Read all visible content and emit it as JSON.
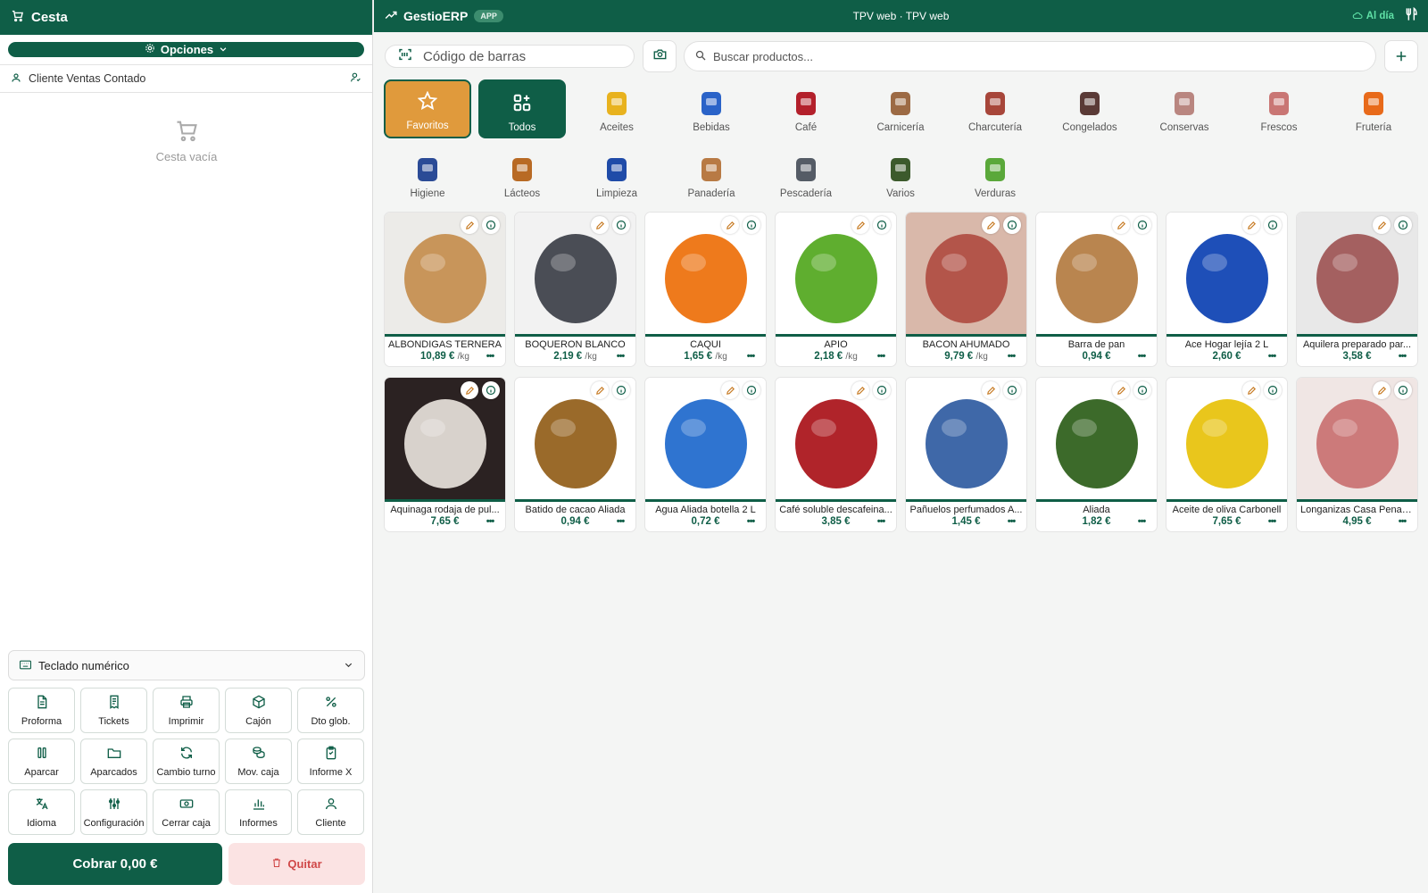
{
  "left": {
    "title": "Cesta",
    "options_label": "Opciones",
    "client": "Cliente Ventas Contado",
    "empty_label": "Cesta vacía",
    "numpad_label": "Teclado numérico",
    "actions": [
      {
        "label": "Proforma",
        "icon": "file-text-icon"
      },
      {
        "label": "Tickets",
        "icon": "receipt-icon"
      },
      {
        "label": "Imprimir",
        "icon": "printer-icon"
      },
      {
        "label": "Cajón",
        "icon": "box-icon"
      },
      {
        "label": "Dto glob.",
        "icon": "percent-icon"
      },
      {
        "label": "Aparcar",
        "icon": "pause-icon"
      },
      {
        "label": "Aparcados",
        "icon": "folder-icon"
      },
      {
        "label": "Cambio turno",
        "icon": "refresh-icon"
      },
      {
        "label": "Mov. caja",
        "icon": "coins-icon"
      },
      {
        "label": "Informe X",
        "icon": "clipboard-icon"
      },
      {
        "label": "Idioma",
        "icon": "translate-icon"
      },
      {
        "label": "Configuración",
        "icon": "sliders-icon"
      },
      {
        "label": "Cerrar caja",
        "icon": "banknote-icon"
      },
      {
        "label": "Informes",
        "icon": "bar-chart-icon"
      },
      {
        "label": "Cliente",
        "icon": "user-icon"
      }
    ],
    "cobrar_label": "Cobrar 0,00 €",
    "quitar_label": "Quitar"
  },
  "topbar": {
    "brand": "GestioERP",
    "badge": "APP",
    "center": "TPV web · TPV web",
    "sync": "Al día"
  },
  "search": {
    "barcode_placeholder": "Código de barras",
    "products_placeholder": "Buscar productos..."
  },
  "categories": [
    {
      "label": "Favoritos",
      "kind": "fav"
    },
    {
      "label": "Todos",
      "kind": "all"
    },
    {
      "label": "Aceites",
      "color": "#e8b21e"
    },
    {
      "label": "Bebidas",
      "color": "#2a63c8"
    },
    {
      "label": "Café",
      "color": "#b3202b"
    },
    {
      "label": "Carnicería",
      "color": "#9c6a44"
    },
    {
      "label": "Charcutería",
      "color": "#a7463a"
    },
    {
      "label": "Congelados",
      "color": "#5a3a36"
    },
    {
      "label": "Conservas",
      "color": "#b98680"
    },
    {
      "label": "Frescos",
      "color": "#c97674"
    },
    {
      "label": "Frutería",
      "color": "#e86a1a"
    },
    {
      "label": "Higiene",
      "color": "#2b4b96"
    },
    {
      "label": "Lácteos",
      "color": "#b86a24"
    },
    {
      "label": "Limpieza",
      "color": "#1f4ba8"
    },
    {
      "label": "Panadería",
      "color": "#b87a44"
    },
    {
      "label": "Pescadería",
      "color": "#555c66"
    },
    {
      "label": "Varios",
      "color": "#3c5a2c"
    },
    {
      "label": "Verduras",
      "color": "#5aa83a"
    }
  ],
  "products": [
    {
      "name": "ALBONDIGAS TERNERA",
      "price": "10,89 €",
      "unit": "/kg",
      "color": "#c8955a",
      "bg": "#ecebe8"
    },
    {
      "name": "BOQUERON BLANCO",
      "price": "2,19 €",
      "unit": "/kg",
      "color": "#4a4d55",
      "bg": "#f2f2f2"
    },
    {
      "name": "CAQUI",
      "price": "1,65 €",
      "unit": "/kg",
      "color": "#ee7a1c",
      "bg": "#ffffff"
    },
    {
      "name": "APIO",
      "price": "2,18 €",
      "unit": "/kg",
      "color": "#5fae2f",
      "bg": "#ffffff"
    },
    {
      "name": "BACON AHUMADO",
      "price": "9,79 €",
      "unit": "/kg",
      "color": "#b3554a",
      "bg": "#d9b8aa"
    },
    {
      "name": "Barra de pan",
      "price": "0,94 €",
      "unit": "",
      "color": "#b9854f",
      "bg": "#ffffff"
    },
    {
      "name": "Ace Hogar lejía 2 L",
      "price": "2,60 €",
      "unit": "",
      "color": "#1e4fb8",
      "bg": "#ffffff"
    },
    {
      "name": "Aquilera preparado par...",
      "price": "3,58 €",
      "unit": "",
      "color": "#a46060",
      "bg": "#e8e8e8"
    },
    {
      "name": "Aquinaga rodaja de pul...",
      "price": "7,65 €",
      "unit": "",
      "color": "#d8d2cc",
      "bg": "#2b2222"
    },
    {
      "name": "Batido de cacao Aliada",
      "price": "0,94 €",
      "unit": "",
      "color": "#9a6a2a",
      "bg": "#ffffff"
    },
    {
      "name": "Agua Aliada botella 2 L",
      "price": "0,72 €",
      "unit": "",
      "color": "#2f74d0",
      "bg": "#ffffff"
    },
    {
      "name": "Café soluble descafeina...",
      "price": "3,85 €",
      "unit": "",
      "color": "#b0242a",
      "bg": "#ffffff"
    },
    {
      "name": "Pañuelos perfumados A...",
      "price": "1,45 €",
      "unit": "",
      "color": "#3f68a8",
      "bg": "#ffffff"
    },
    {
      "name": "Aliada",
      "price": "1,82 €",
      "unit": "",
      "color": "#3c6a2a",
      "bg": "#ffffff"
    },
    {
      "name": "Aceite de oliva Carbonell",
      "price": "7,65 €",
      "unit": "",
      "color": "#e9c61c",
      "bg": "#ffffff"
    },
    {
      "name": "Longanizas Casa Penalva",
      "price": "4,95 €",
      "unit": "",
      "color": "#cc7a7a",
      "bg": "#f0e6e4"
    }
  ]
}
